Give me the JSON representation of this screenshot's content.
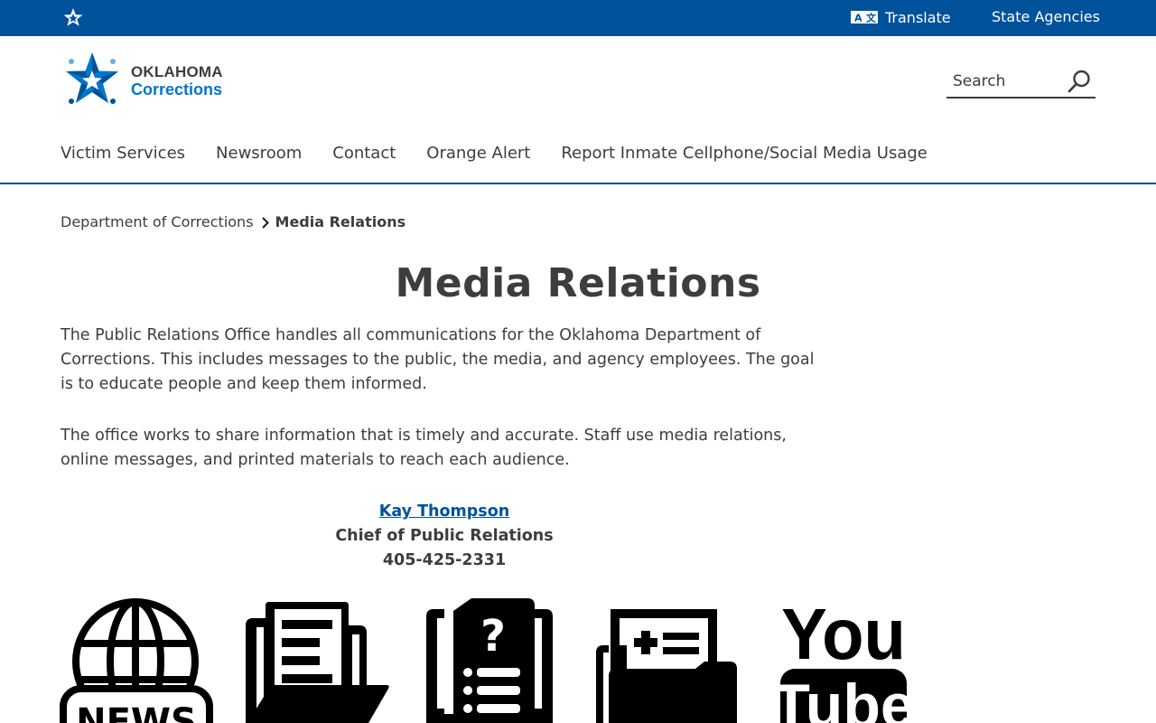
{
  "topbar": {
    "translate_label": "Translate",
    "agencies_label": "State Agencies"
  },
  "logo": {
    "line1": "OKLAHOMA",
    "line2": "Corrections"
  },
  "search": {
    "placeholder": "Search"
  },
  "nav": {
    "items": [
      {
        "label": "Victim Services"
      },
      {
        "label": "Newsroom"
      },
      {
        "label": "Contact"
      },
      {
        "label": "Orange Alert"
      },
      {
        "label": "Report Inmate Cellphone/Social Media Usage"
      }
    ]
  },
  "breadcrumb": {
    "parent": "Department of Corrections",
    "current": "Media Relations"
  },
  "main": {
    "title": "Media Relations",
    "paragraph1": "The Public Relations Office handles all communications for the Oklahoma Department of Corrections. This includes messages to the public, the media, and agency employees. The goal is to educate people and keep them informed.",
    "paragraph2": "The office works to share information that is timely and accurate. Staff use media relations, online messages, and printed materials to reach each audience."
  },
  "contact": {
    "name": "Kay Thompson",
    "title": "Chief of Public Relations",
    "phone": "405-425-2331"
  },
  "icons": {
    "news_text": "NEWS",
    "youtube_you": "You",
    "youtube_tube": "Tube"
  },
  "colors": {
    "brand_blue": "#00529b",
    "logo_blue": "#0077c8",
    "text": "#3d3d3d"
  }
}
